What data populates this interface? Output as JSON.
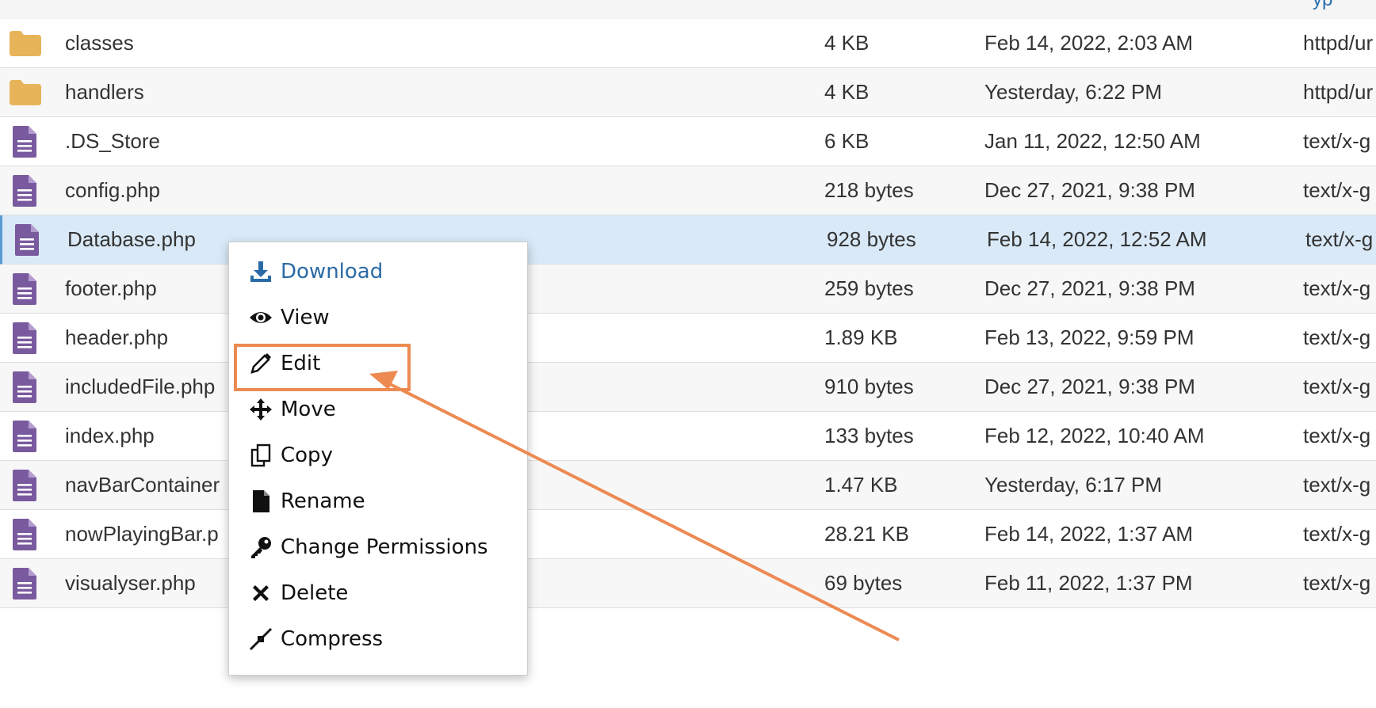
{
  "files": [
    {
      "kind": "folder",
      "name": "classes",
      "size": "4 KB",
      "date": "Feb 14, 2022, 2:03 AM",
      "type": "httpd/ur"
    },
    {
      "kind": "folder",
      "name": "handlers",
      "size": "4 KB",
      "date": "Yesterday, 6:22 PM",
      "type": "httpd/ur"
    },
    {
      "kind": "file",
      "name": ".DS_Store",
      "size": "6 KB",
      "date": "Jan 11, 2022, 12:50 AM",
      "type": "text/x-g"
    },
    {
      "kind": "file",
      "name": "config.php",
      "size": "218 bytes",
      "date": "Dec 27, 2021, 9:38 PM",
      "type": "text/x-g"
    },
    {
      "kind": "file",
      "name": "Database.php",
      "size": "928 bytes",
      "date": "Feb 14, 2022, 12:52 AM",
      "type": "text/x-g",
      "selected": true
    },
    {
      "kind": "file",
      "name": "footer.php",
      "size": "259 bytes",
      "date": "Dec 27, 2021, 9:38 PM",
      "type": "text/x-g"
    },
    {
      "kind": "file",
      "name": "header.php",
      "size": "1.89 KB",
      "date": "Feb 13, 2022, 9:59 PM",
      "type": "text/x-g"
    },
    {
      "kind": "file",
      "name": "includedFile.php",
      "size": "910 bytes",
      "date": "Dec 27, 2021, 9:38 PM",
      "type": "text/x-g"
    },
    {
      "kind": "file",
      "name": "index.php",
      "size": "133 bytes",
      "date": "Feb 12, 2022, 10:40 AM",
      "type": "text/x-g"
    },
    {
      "kind": "file",
      "name": "navBarContainer",
      "size": "1.47 KB",
      "date": "Yesterday, 6:17 PM",
      "type": "text/x-g"
    },
    {
      "kind": "file",
      "name": "nowPlayingBar.p",
      "size": "28.21 KB",
      "date": "Feb 14, 2022, 1:37 AM",
      "type": "text/x-g"
    },
    {
      "kind": "file",
      "name": "visualyser.php",
      "size": "69 bytes",
      "date": "Feb 11, 2022, 1:37 PM",
      "type": "text/x-g"
    }
  ],
  "context_menu": {
    "download": "Download",
    "view": "View",
    "edit": "Edit",
    "move": "Move",
    "copy": "Copy",
    "rename": "Rename",
    "change_permissions": "Change Permissions",
    "delete": "Delete",
    "compress": "Compress"
  },
  "colors": {
    "folder_icon": "#e8b45a",
    "file_icon": "#7a5a9e",
    "selected_row": "#d9e9f7",
    "annotation": "#ec8a52",
    "link_blue": "#2a6aa6"
  }
}
